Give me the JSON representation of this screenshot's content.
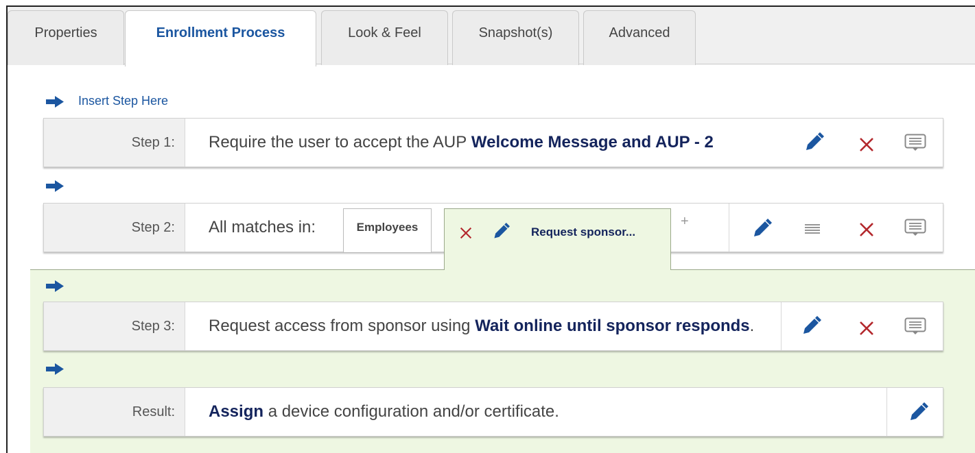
{
  "tabs": [
    {
      "label": "Properties",
      "active": false
    },
    {
      "label": "Enrollment Process",
      "active": true
    },
    {
      "label": "Look & Feel",
      "active": false
    },
    {
      "label": "Snapshot(s)",
      "active": false
    },
    {
      "label": "Advanced",
      "active": false
    }
  ],
  "insert_step_label": "Insert Step Here",
  "steps": [
    {
      "label": "Step 1:",
      "text_plain": "Require the user to accept the AUP",
      "text_bold": "Welcome Message and AUP - 2"
    },
    {
      "label": "Step 2:",
      "text_plain": "All matches in:",
      "group_tab": "Employees",
      "sponsor_tab": "Request sponsor...",
      "add_tab": "+"
    },
    {
      "label": "Step 3:",
      "text_plain": "Request access from sponsor using",
      "text_bold": "Wait online until sponsor responds",
      "text_suffix": "."
    },
    {
      "label": "Result:",
      "text_bold": "Assign",
      "text_plain": "a device configuration and/or certificate."
    }
  ],
  "colors": {
    "accent_blue": "#1b56a0",
    "delete_red": "#b3282d",
    "green_panel": "#eef7e2",
    "bold_text": "#14245c"
  },
  "icons": [
    "arrow-right-icon",
    "pencil-icon",
    "close-icon",
    "list-icon",
    "comment-icon"
  ]
}
